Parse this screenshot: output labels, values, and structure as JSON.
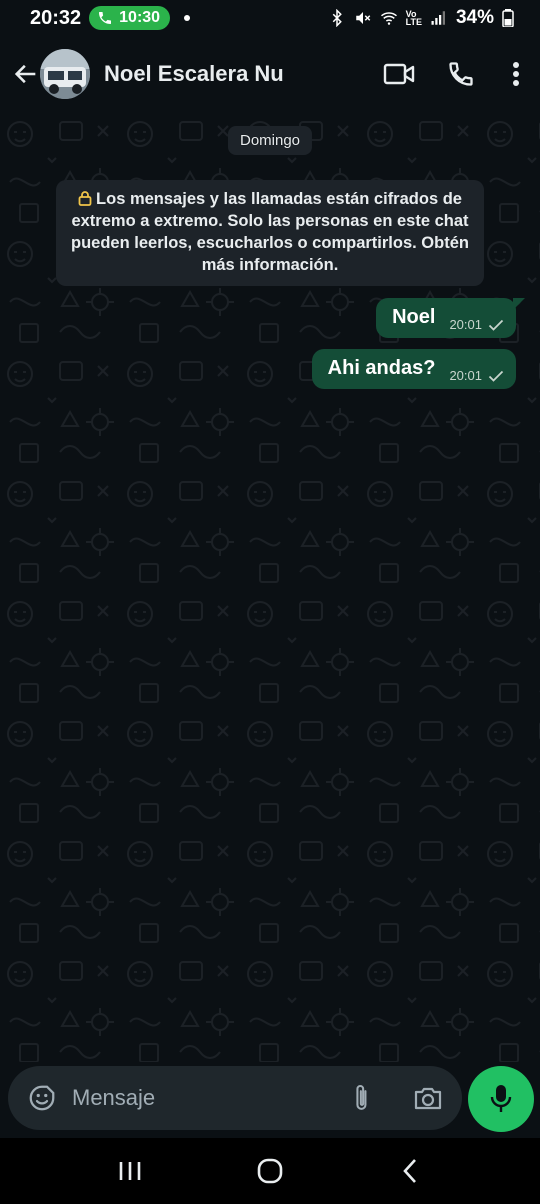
{
  "status_bar": {
    "time": "20:32",
    "call_timer": "10:30",
    "battery": "34%",
    "network_label_top": "Vo",
    "network_label_bottom": "LTE"
  },
  "header": {
    "contact_name": "Noel Escalera Nu"
  },
  "chat": {
    "date_label": "Domingo",
    "encryption_notice": "Los mensajes y las llamadas están cifrados de extremo a extremo. Solo las personas en este chat pueden leerlos, escucharlos o compartirlos. Obtén más información.",
    "messages": [
      {
        "text": "Noel",
        "time": "20:01",
        "status": "sent"
      },
      {
        "text": "Ahi andas?",
        "time": "20:01",
        "status": "sent"
      }
    ]
  },
  "composer": {
    "placeholder": "Mensaje"
  },
  "colors": {
    "background": "#0b1014",
    "outgoing_bubble": "#144d37",
    "accent_green": "#21c063",
    "call_pill": "#2bb34b",
    "system_chip": "#1d2329",
    "input_background": "#1f272c"
  },
  "icons": {
    "header": [
      "back-arrow-icon",
      "video-call-icon",
      "voice-call-icon",
      "more-options-icon"
    ],
    "composer": [
      "emoji-sticker-icon",
      "attach-icon",
      "camera-icon",
      "microphone-icon"
    ],
    "nav": [
      "recent-apps-icon",
      "home-icon",
      "back-icon"
    ]
  }
}
